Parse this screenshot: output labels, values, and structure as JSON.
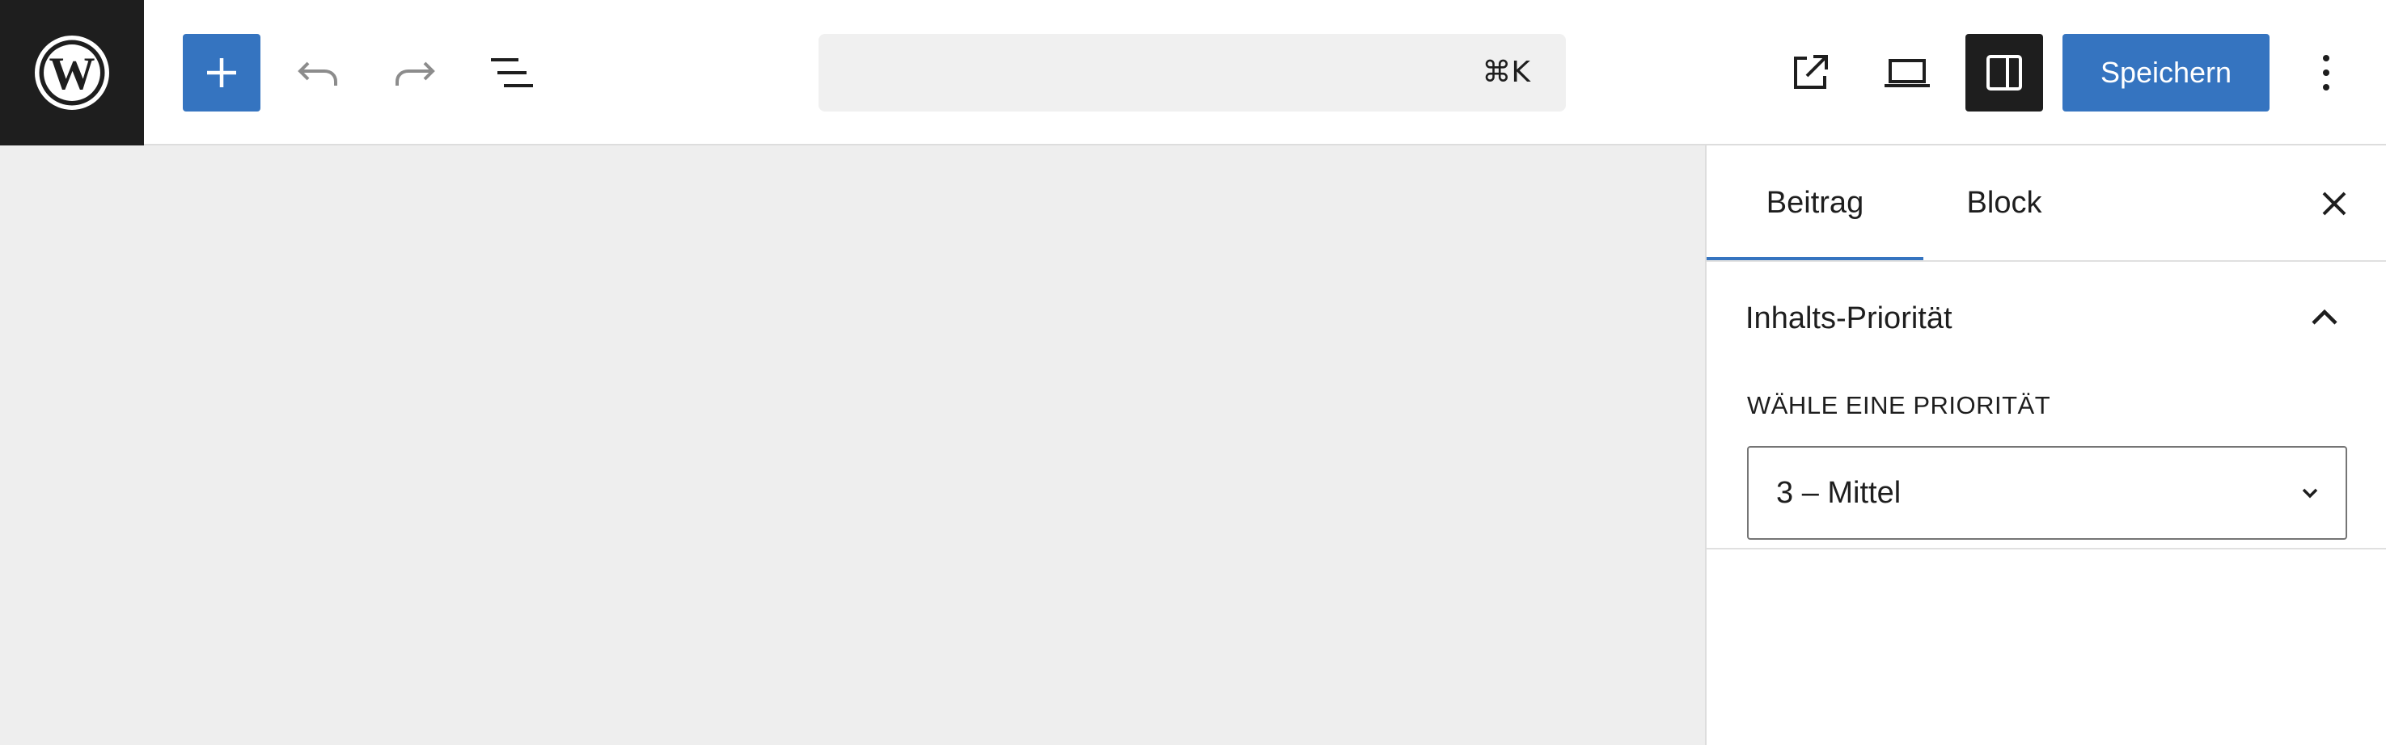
{
  "header": {
    "logo_icon": "wordpress-logo-icon",
    "toolbar": {
      "inserter_icon": "plus-icon",
      "undo_icon": "undo-icon",
      "redo_icon": "redo-icon",
      "list_view_icon": "list-view-icon"
    },
    "command_bar": {
      "shortcut": "⌘K"
    },
    "actions": {
      "view_post_icon": "external-link-icon",
      "preview_icon": "desktop-preview-icon",
      "settings_icon": "sidebar-toggle-icon",
      "save_label": "Speichern",
      "options_icon": "more-vertical-icon"
    }
  },
  "sidebar": {
    "tabs": [
      {
        "label": "Beitrag",
        "active": true
      },
      {
        "label": "Block",
        "active": false
      }
    ],
    "close_icon": "close-icon",
    "panel": {
      "title": "Inhalts-Priorität",
      "expanded": true,
      "field_label": "WÄHLE EINE PRIORITÄT",
      "selected_value": "3 – Mittel"
    }
  },
  "colors": {
    "accent": "#3574c0",
    "dark": "#1e1e1e",
    "canvas": "#eeeeee",
    "command_bar": "#f0f0f0"
  }
}
